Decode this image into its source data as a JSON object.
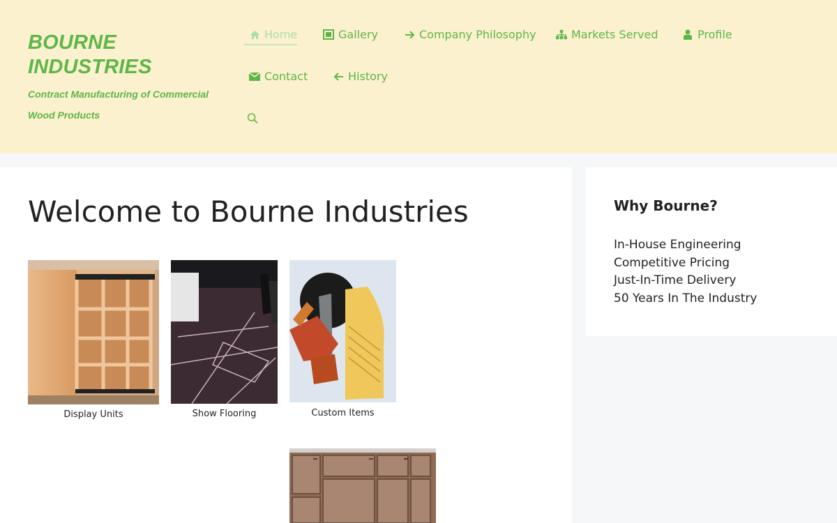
{
  "header": {
    "site_title_line1": "BOURNE",
    "site_title_line2": "INDUSTRIES",
    "tagline": "Contract Manufacturing of Commercial Wood Products",
    "nav": [
      {
        "label": "Home",
        "icon": "home-icon",
        "active": true
      },
      {
        "label": "Gallery",
        "icon": "image-icon",
        "active": false
      },
      {
        "label": "Company Philosophy",
        "icon": "arrow-right-icon",
        "active": false
      },
      {
        "label": "Markets Served",
        "icon": "sitemap-icon",
        "active": false
      },
      {
        "label": "Profile",
        "icon": "user-icon",
        "active": false
      },
      {
        "label": "Contact",
        "icon": "envelope-icon",
        "active": false
      },
      {
        "label": "History",
        "icon": "arrow-left-icon",
        "active": false
      }
    ],
    "search_icon": "search-icon"
  },
  "main": {
    "title": "Welcome to Bourne Industries",
    "gallery": [
      {
        "caption": "Display Units"
      },
      {
        "caption": "Show Flooring"
      },
      {
        "caption": "Custom Items"
      },
      {
        "caption": ""
      }
    ]
  },
  "sidebar": {
    "title": "Why Bourne?",
    "items": [
      "In-House Engineering",
      "Competitive Pricing",
      "Just-In-Time Delivery",
      "50 Years In The Industry"
    ]
  },
  "colors": {
    "header_bg": "#fcf1cf",
    "brand_green": "#5db646",
    "active_nav": "#a8dfa8",
    "page_bg": "#f6f7f8",
    "text": "#222222"
  }
}
